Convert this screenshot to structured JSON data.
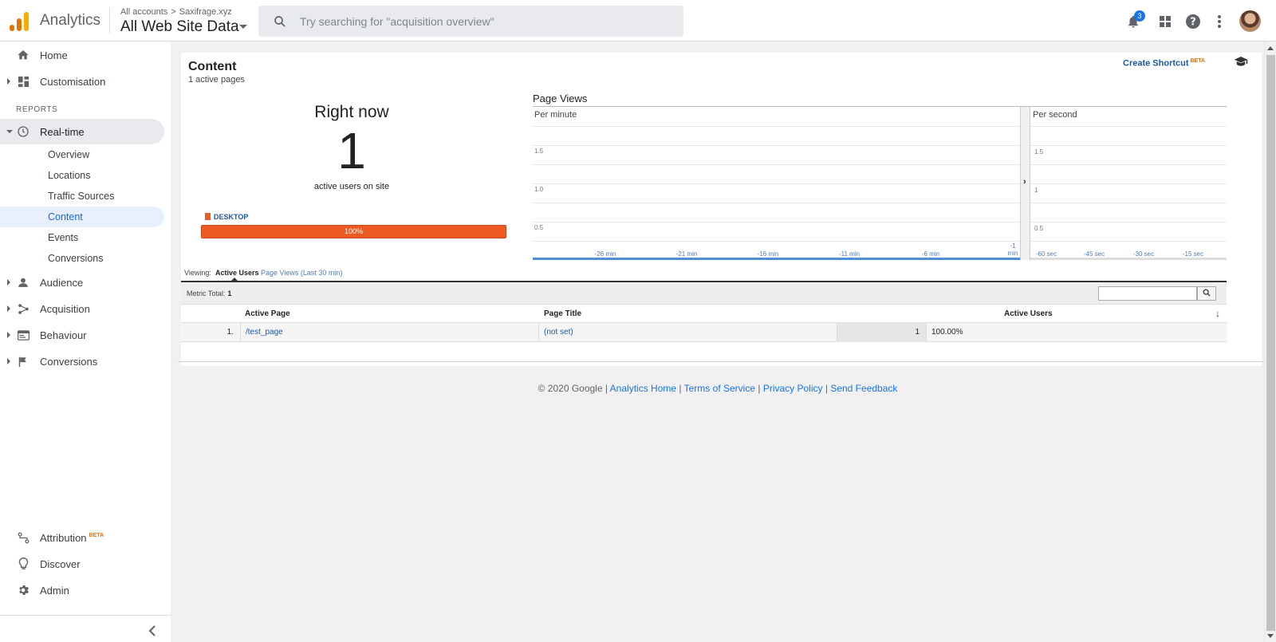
{
  "header": {
    "app_name": "Analytics",
    "logo_colors": [
      "#f9ab00",
      "#e37400",
      "#e37400"
    ],
    "breadcrumb_root": "All accounts",
    "breadcrumb_account": "Saxifrage.xyz",
    "property_view": "All Web Site Data",
    "search_placeholder": "Try searching for \"acquisition overview\"",
    "notification_count": "3"
  },
  "sidebar": {
    "home": "Home",
    "customisation": "Customisation",
    "reports_heading": "REPORTS",
    "realtime": "Real-time",
    "realtime_children": [
      "Overview",
      "Locations",
      "Traffic Sources",
      "Content",
      "Events",
      "Conversions"
    ],
    "audience": "Audience",
    "acquisition": "Acquisition",
    "behaviour": "Behaviour",
    "conversions": "Conversions",
    "attribution": "Attribution",
    "attribution_badge": "BETA",
    "discover": "Discover",
    "admin": "Admin"
  },
  "report": {
    "title": "Content",
    "subtitle": "1 active pages",
    "create_shortcut": "Create Shortcut",
    "create_shortcut_badge": "BETA",
    "right_now_label": "Right now",
    "active_users_count": "1",
    "active_users_caption": "active users on site",
    "device_label": "DESKTOP",
    "device_percent_label": "100%",
    "device_share": 1.0,
    "accent_color": "#ec5b24"
  },
  "chart_data": {
    "type": "bar",
    "title": "Page Views",
    "panels": [
      {
        "label": "Per minute",
        "y_ticks": [
          "1.5",
          "1.0",
          "0.5"
        ],
        "x_ticks": [
          "-26 min",
          "-21 min",
          "-16 min",
          "-11 min",
          "-6 min",
          "-1 min"
        ],
        "values": []
      },
      {
        "label": "Per second",
        "y_ticks": [
          "1.5",
          "1",
          "0.5"
        ],
        "x_ticks": [
          "-60 sec",
          "-45 sec",
          "-30 sec",
          "-15 sec"
        ],
        "values": []
      }
    ]
  },
  "table": {
    "viewing_label": "Viewing:",
    "tab_active": "Active Users",
    "tab_other": "Page Views (Last 30 min)",
    "metric_total_label": "Metric Total:",
    "metric_total_value": "1",
    "columns": [
      "Active Page",
      "Page Title",
      "Active Users"
    ],
    "rows": [
      {
        "index": "1.",
        "page": "/test_page",
        "title": "(not set)",
        "users": "1",
        "percent": "100.00%"
      }
    ]
  },
  "footer": {
    "copyright": "© 2020 Google",
    "links": [
      "Analytics Home",
      "Terms of Service",
      "Privacy Policy",
      "Send Feedback"
    ],
    "separator": "|"
  }
}
